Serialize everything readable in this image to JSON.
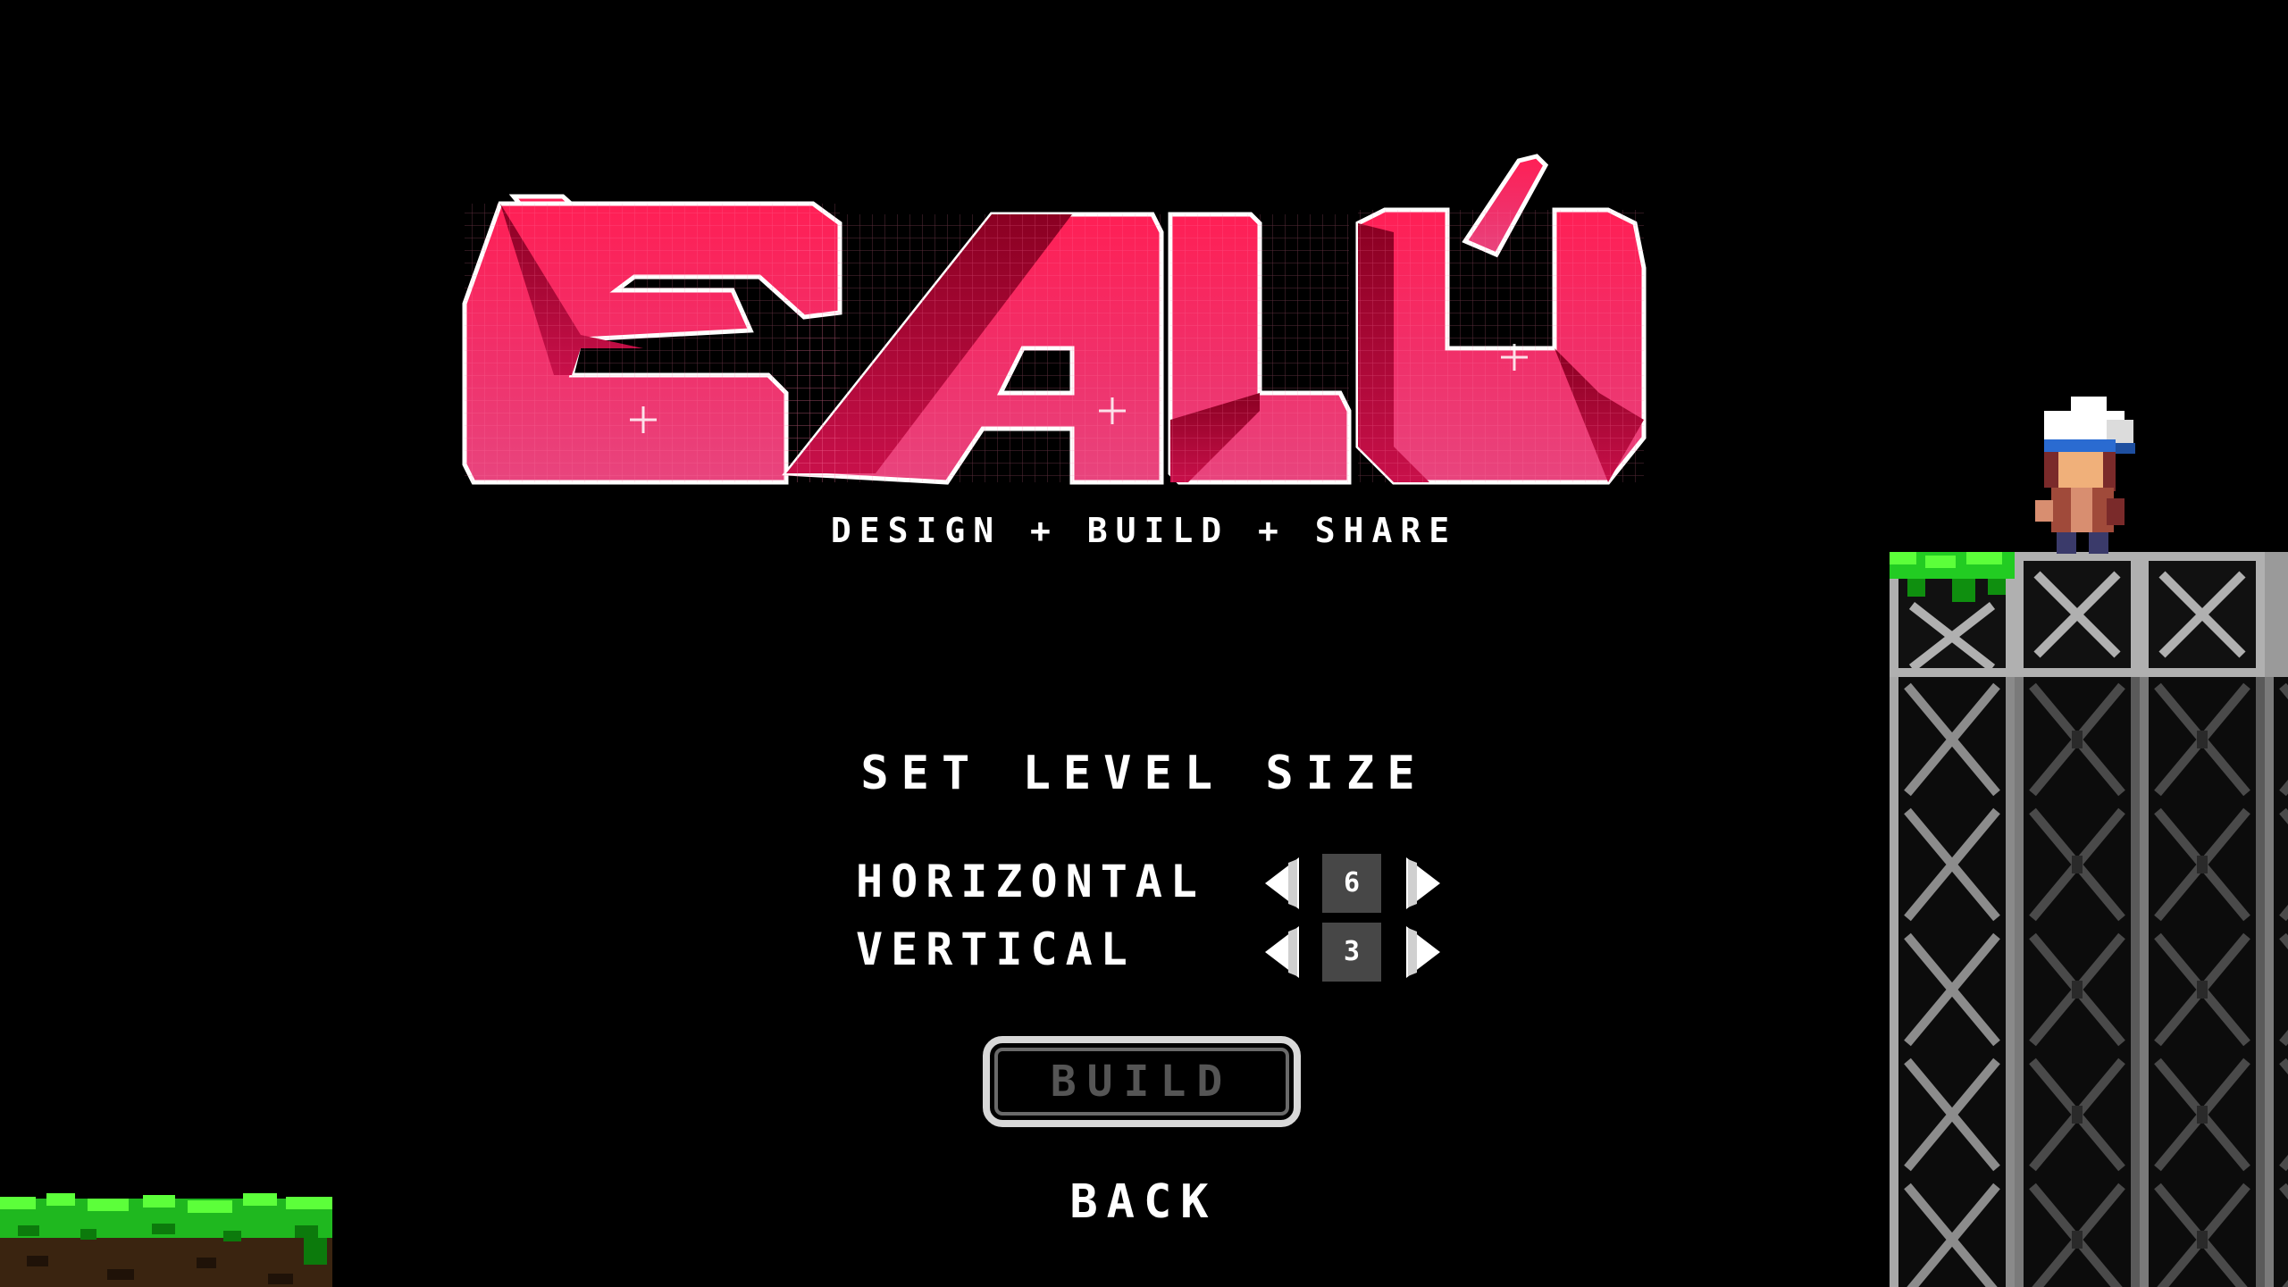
{
  "logo": {
    "title": "ÈALÚ",
    "tagline": "DESIGN  +  BUILD  +  SHARE"
  },
  "menu": {
    "title": "SET LEVEL SIZE",
    "horizontal": {
      "label": "HORIZONTAL",
      "value": "6"
    },
    "vertical": {
      "label": "VERTICAL",
      "value": "3"
    },
    "build_label": "BUILD",
    "back_label": "BACK"
  },
  "colors": {
    "background": "#000000",
    "logo_pink_light": "#ff4f86",
    "logo_pink_dark": "#c4003a",
    "text": "#ffffff",
    "value_box": "#474747",
    "button_disabled_text": "#555555",
    "grass": "#22dd22",
    "tower_metal": "#8a8a8a"
  },
  "icons": {
    "decrease": "arrow-left-icon",
    "increase": "arrow-right-icon"
  }
}
